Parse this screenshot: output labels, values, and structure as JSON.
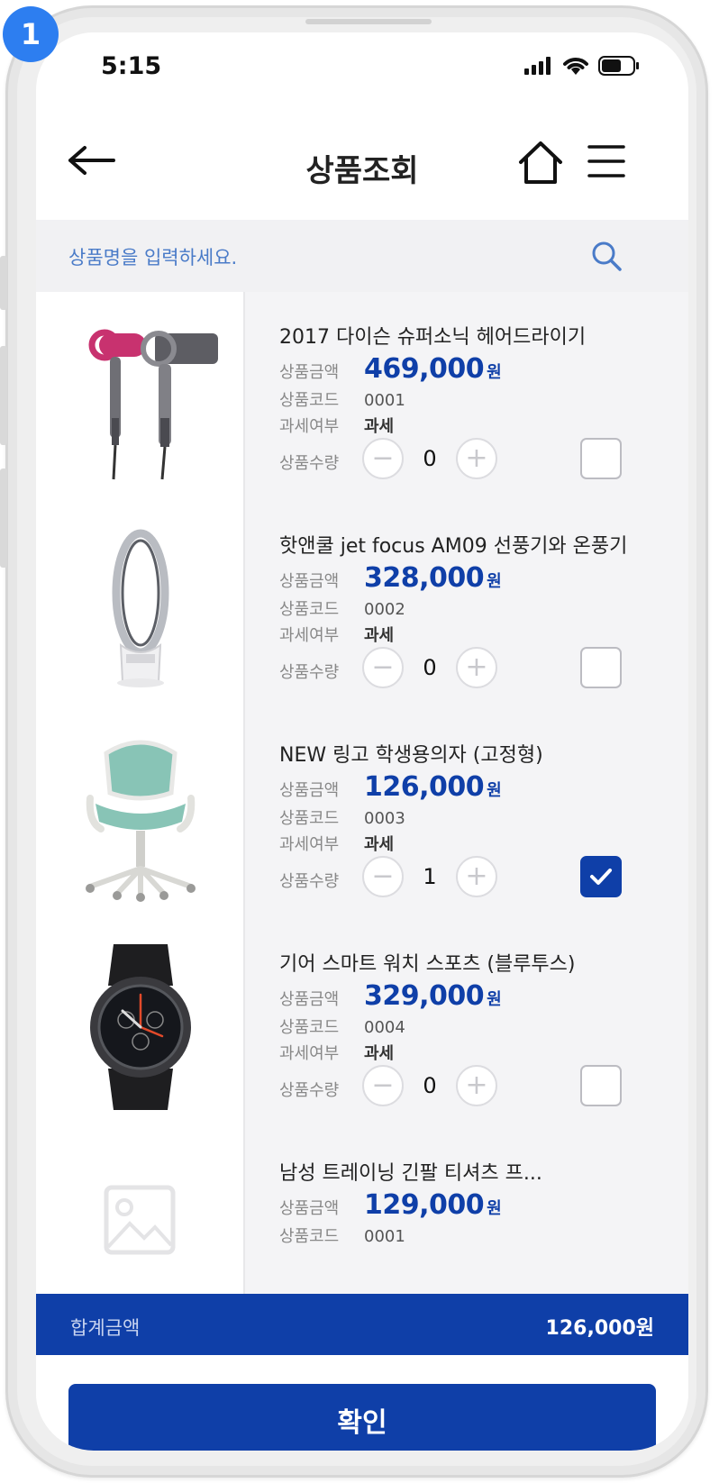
{
  "badge": "1",
  "status_bar": {
    "time": "5:15"
  },
  "header": {
    "title": "상품조회"
  },
  "search": {
    "placeholder": "상품명을 입력하세요."
  },
  "labels": {
    "price": "상품금액",
    "code": "상품코드",
    "tax": "과세여부",
    "quantity": "상품수량",
    "won": "원"
  },
  "products": [
    {
      "name": "2017 다이슨 슈퍼소닉 헤어드라이기",
      "price": "469,000",
      "code": "0001",
      "tax": "과세",
      "quantity": "0",
      "checked": false,
      "image": "hair-dryer"
    },
    {
      "name": "핫앤쿨 jet focus AM09 선풍기와 온풍기",
      "price": "328,000",
      "code": "0002",
      "tax": "과세",
      "quantity": "0",
      "checked": false,
      "image": "fan-heater"
    },
    {
      "name": "NEW 링고 학생용의자 (고정형)",
      "price": "126,000",
      "code": "0003",
      "tax": "과세",
      "quantity": "1",
      "checked": true,
      "image": "chair"
    },
    {
      "name": "기어 스마트 워치 스포츠 (블루투스)",
      "price": "329,000",
      "code": "0004",
      "tax": "과세",
      "quantity": "0",
      "checked": false,
      "image": "smartwatch"
    },
    {
      "name": "남성 트레이닝 긴팔 티셔츠 프...",
      "price": "129,000",
      "code": "0001",
      "tax": "",
      "quantity": "",
      "checked": false,
      "image": "placeholder-image"
    }
  ],
  "total": {
    "label": "합계금액",
    "amount": "126,000원"
  },
  "confirm_button": {
    "label": "확인"
  },
  "colors": {
    "primary": "#0f3fa8",
    "badge": "#2d7ef0",
    "list_bg": "#f4f4f6"
  }
}
